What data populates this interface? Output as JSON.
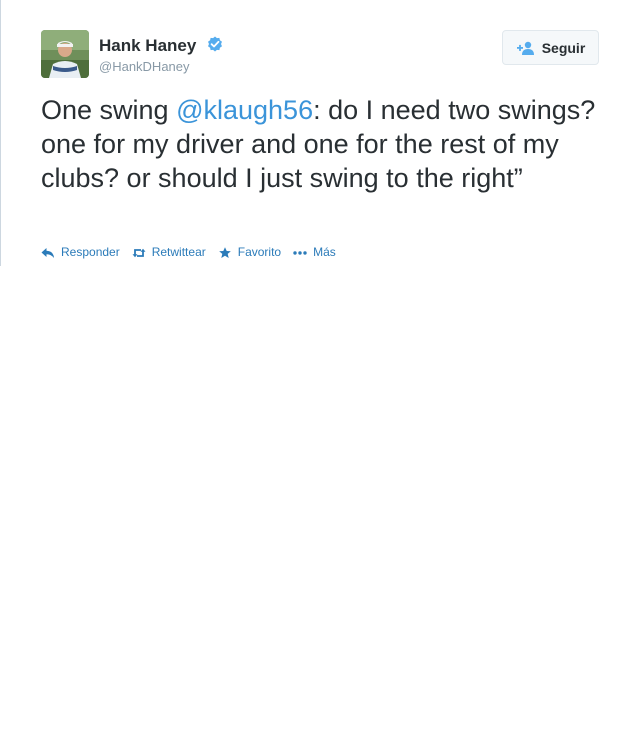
{
  "user": {
    "display_name": "Hank Haney",
    "handle": "@HankDHaney",
    "verified": true
  },
  "follow_button": {
    "label": "Seguir",
    "icon": "add-person-icon"
  },
  "tweet": {
    "text_before": "One swing ",
    "mention": "@klaugh56",
    "text_after": ":  do I need two swings?  one for my driver and one for the rest of my clubs? or should I just swing to the right”"
  },
  "actions": {
    "reply": {
      "label": "Responder",
      "icon": "reply-icon"
    },
    "retweet": {
      "label": "Retwittear",
      "icon": "retweet-icon"
    },
    "favorite": {
      "label": "Favorito",
      "icon": "star-icon"
    },
    "more": {
      "label": "Más",
      "icon": "more-dots-icon"
    }
  },
  "colors": {
    "text": "#292f33",
    "link": "#3b94d9",
    "action": "#2b7bb9",
    "secondary": "#8899a6",
    "verified": "#55acee"
  }
}
